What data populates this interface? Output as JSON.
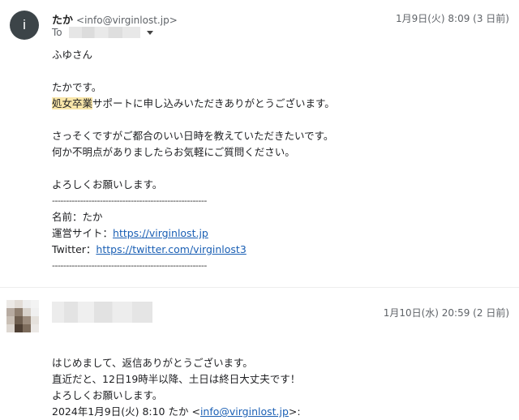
{
  "message1": {
    "avatar_letter": "i",
    "sender_name": "たか",
    "sender_email": "<info@virginlost.jp>",
    "date": "1月9日(火) 8:09 (3 日前)",
    "to_label": "To",
    "body": {
      "greeting": "ふゆさん",
      "line_intro": "たかです。",
      "highlight": "処女卒業",
      "line_thanks_rest": "サポートに申し込みいただきありがとうございます。",
      "line_ask1": "さっそくですがご都合のいい日時を教えていただきたいです。",
      "line_ask2": "何か不明点がありましたらお気軽にご質問ください。",
      "line_regards": "よろしくお願いします。",
      "separator": "-------------------------------------------------------",
      "sig_name": "名前：たか",
      "sig_site_label": "運営サイト：",
      "sig_site_url": "https://virginlost.jp",
      "sig_twitter_label": "Twitter：",
      "sig_twitter_url": "https://twitter.com/virginlost3"
    }
  },
  "message2": {
    "date": "1月10日(水) 20:59 (2 日前)",
    "body": {
      "line1": "はじめまして、返信ありがとうございます。",
      "line2": "直近だと、12日19時半以降、土日は終日大丈夫です！",
      "line3": "よろしくお願いします。",
      "quote_prefix": "2024年1月9日(火) 8:10 たか <",
      "quote_email": "info@virginlost.jp",
      "quote_suffix": ">:"
    }
  }
}
